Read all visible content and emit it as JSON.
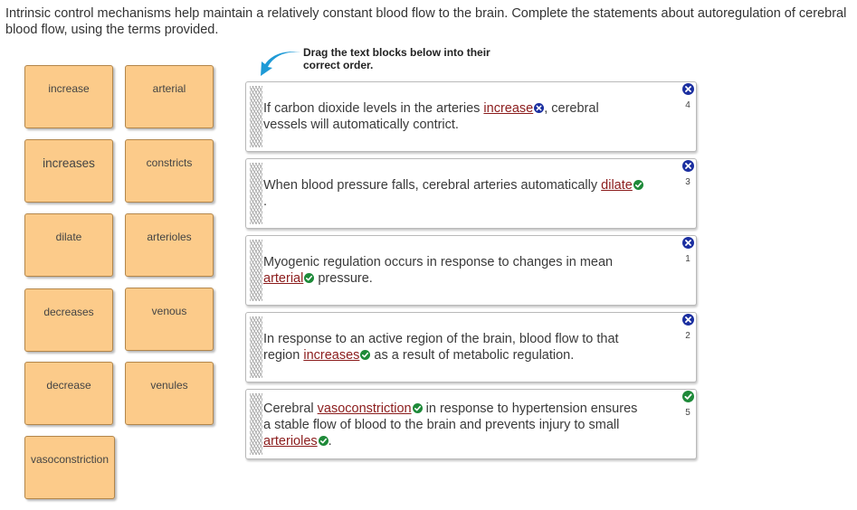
{
  "instructions": "Intrinsic control mechanisms help maintain a relatively constant blood flow to the brain. Complete the statements about autoregulation of cerebral blood flow, using the terms provided.",
  "hint": "Drag the text blocks below into their correct order.",
  "word_bank": {
    "col1": [
      "increase",
      "increases",
      "dilate",
      "decreases",
      "decrease",
      "vasoconstriction"
    ],
    "col2": [
      "arterial",
      "constricts",
      "arterioles",
      "venous",
      "venules"
    ]
  },
  "statements": [
    {
      "pre": "If carbon dioxide levels in the arteries ",
      "ans1": "increase",
      "mid": ", cerebral vessels will automatically contrict.",
      "post": "",
      "order": "4",
      "order_status": "wrong"
    },
    {
      "pre": "When blood pressure falls, cerebral arteries automatically ",
      "ans1": "dilate",
      "mid": ".",
      "post": "",
      "order": "3",
      "order_status": "wrong"
    },
    {
      "pre": "Myogenic regulation occurs in response to changes in mean ",
      "ans1": "arterial",
      "mid": " pressure.",
      "post": "",
      "order": "1",
      "order_status": "wrong"
    },
    {
      "pre": "In response to an active region of the brain, blood flow to that region ",
      "ans1": "increases",
      "mid": " as a result of metabolic regulation.",
      "post": "",
      "order": "2",
      "order_status": "wrong"
    },
    {
      "pre": "Cerebral ",
      "ans1": "vasoconstriction",
      "mid": " in response to hypertension ensures a stable flow of blood to the brain and prevents injury to small ",
      "ans2": "arterioles",
      "post": ".",
      "order": "5",
      "order_status": "correct"
    }
  ],
  "colors": {
    "tile": "#fccb8a",
    "answer": "#8b1c1c",
    "correct": "#1e8a39",
    "wrong": "#1b2fa0",
    "arrow": "#1e9ad6"
  }
}
